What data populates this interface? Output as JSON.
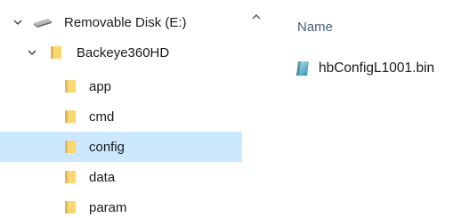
{
  "nav_tree": {
    "drive": {
      "label": "Removable Disk (E:)",
      "icon": "usb-drive-icon"
    },
    "root_folder": {
      "label": "Backeye360HD",
      "icon": "folder-icon"
    },
    "items": [
      {
        "label": "app",
        "icon": "folder-icon",
        "selected": false
      },
      {
        "label": "cmd",
        "icon": "folder-icon",
        "selected": false
      },
      {
        "label": "config",
        "icon": "folder-icon",
        "selected": true
      },
      {
        "label": "data",
        "icon": "folder-icon",
        "selected": false
      },
      {
        "label": "param",
        "icon": "folder-icon",
        "selected": false
      }
    ]
  },
  "content": {
    "column_header": "Name",
    "files": [
      {
        "name": "hbConfigL1001.bin",
        "icon": "bin-file-icon"
      }
    ]
  },
  "colors": {
    "selection": "#cce8ff",
    "folder": "#f8d775",
    "header_text": "#4c607a"
  }
}
